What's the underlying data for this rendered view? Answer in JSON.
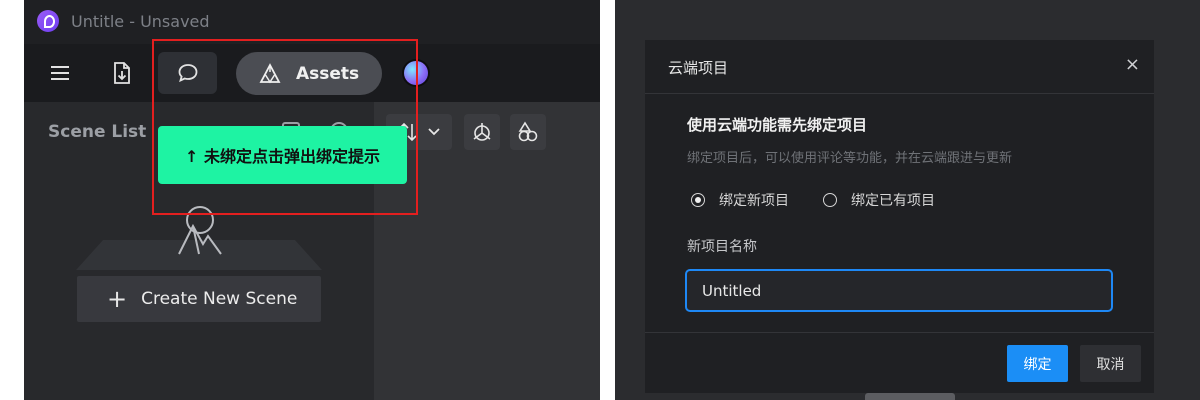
{
  "left_window": {
    "title": "Untitle - Unsaved",
    "toolbar": {
      "assets_label": "Assets"
    },
    "sidebar": {
      "title": "Scene List",
      "create_button_label": "Create New Scene",
      "create_button_icon": "+"
    },
    "hint": {
      "text": "↑ 未绑定点击弹出绑定提示",
      "color": "#1ef3a3"
    },
    "highlight_color": "#e31f1f"
  },
  "dialog": {
    "title": "云端项目",
    "close_icon": "×",
    "heading": "使用云端功能需先绑定项目",
    "subtitle": "绑定项目后，可以使用评论等功能，并在云端跟进与更新",
    "radio_options": [
      {
        "label": "绑定新项目",
        "selected": true
      },
      {
        "label": "绑定已有项目",
        "selected": false
      }
    ],
    "name_field_label": "新项目名称",
    "name_field_value": "Untitled",
    "confirm_label": "绑定",
    "cancel_label": "取消",
    "accent_color": "#1b8ef6"
  }
}
